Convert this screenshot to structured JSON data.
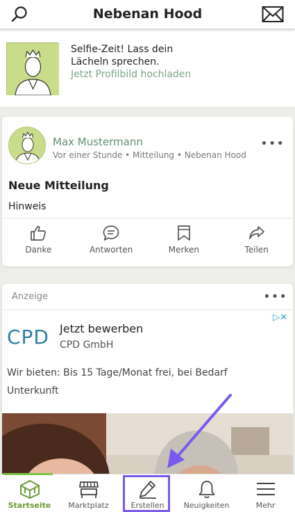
{
  "header": {
    "title": "Nebenan Hood",
    "search_icon": "search-icon",
    "mail_icon": "mail-icon"
  },
  "profile_prompt": {
    "line1": "Selfie-Zeit! Lass dein",
    "line2": "Lächeln sprechen.",
    "link": "Jetzt Profilbild hochladen"
  },
  "post": {
    "author": "Max Mustermann",
    "meta": "Vor einer Stunde • Mitteilung • Nebenan Hood",
    "more": "•••",
    "title": "Neue Mitteilung",
    "body": "Hinweis",
    "actions": [
      {
        "label": "Danke",
        "icon": "thumbs-up-icon"
      },
      {
        "label": "Antworten",
        "icon": "reply-bubble-icon"
      },
      {
        "label": "Merken",
        "icon": "bookmark-icon"
      },
      {
        "label": "Teilen",
        "icon": "share-icon"
      }
    ]
  },
  "ad": {
    "label": "Anzeige",
    "more": "•••",
    "logo": "CPD",
    "title": "Jetzt bewerben",
    "company": "CPD GmbH",
    "adchoices": "▷✕",
    "text_line1": "Wir bieten: Bis 15 Tage/Monat frei, bei Bedarf",
    "text_line2": "Unterkunft"
  },
  "bottom_nav": {
    "active": "Startseite",
    "items": [
      {
        "label": "Startseite",
        "icon": "home-icon"
      },
      {
        "label": "Marktplatz",
        "icon": "market-stall-icon"
      },
      {
        "label": "Erstellen",
        "icon": "pencil-icon"
      },
      {
        "label": "Neuigkeiten",
        "icon": "bell-icon"
      },
      {
        "label": "Mehr",
        "icon": "menu-icon"
      }
    ]
  },
  "colors": {
    "accent_green": "#7cc347",
    "link_green": "#7ca68a",
    "highlight_purple": "#7b59ee",
    "cpd_blue": "#2d7fa5"
  }
}
